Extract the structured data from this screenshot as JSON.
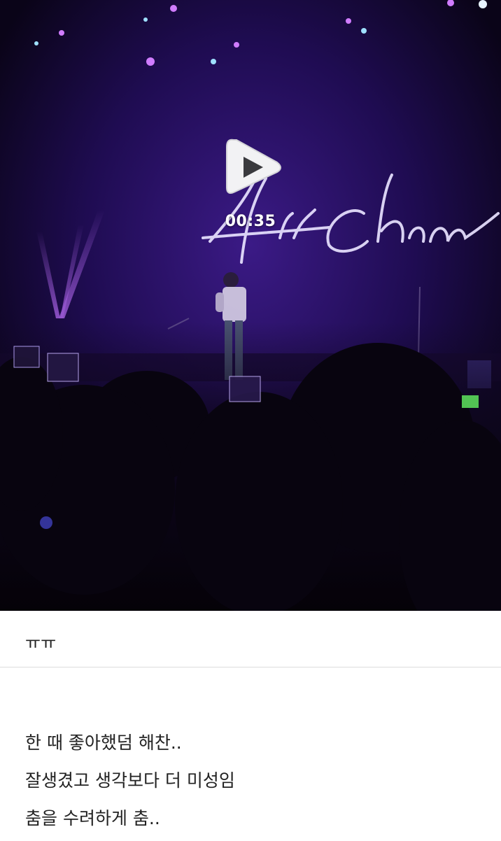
{
  "video": {
    "duration": "00:35",
    "play_icon": "play-icon",
    "stage_sign": "HaeChan",
    "colors": {
      "background": "#0c0620",
      "stage_purple": "#3a1a80",
      "light_beam": "#b060ff"
    }
  },
  "comment": {
    "text": "ㅠㅠ"
  },
  "post": {
    "lines": [
      "한 때 좋아했덤 해찬..",
      "잘생겼고 생각보다 더 미성임",
      "춤을 수려하게 춤.."
    ]
  }
}
